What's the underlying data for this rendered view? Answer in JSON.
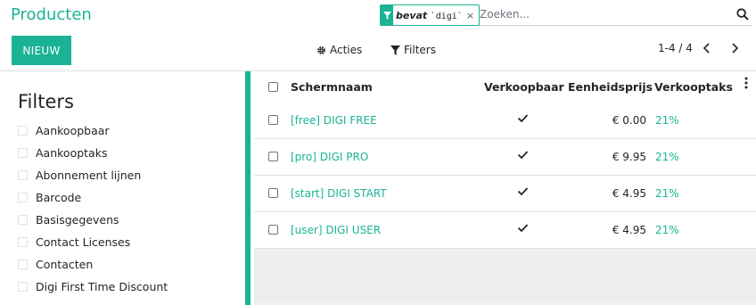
{
  "page_title": "Producten",
  "search": {
    "facet_field": "bevat",
    "facet_value": "`digi`",
    "facet_remove": "×",
    "placeholder": "Zoeken..."
  },
  "toolbar": {
    "new_label": "NIEUW",
    "actions_label": "Acties",
    "filters_label": "Filters",
    "pager": "1-4 / 4"
  },
  "sidebar": {
    "title": "Filters",
    "items": [
      {
        "label": "Aankoopbaar"
      },
      {
        "label": "Aankooptaks"
      },
      {
        "label": "Abonnement lijnen"
      },
      {
        "label": "Barcode"
      },
      {
        "label": "Basisgegevens"
      },
      {
        "label": "Contact Licenses"
      },
      {
        "label": "Contacten"
      },
      {
        "label": "Digi First Time Discount"
      }
    ]
  },
  "table": {
    "columns": [
      "Schermnaam",
      "Verkoopbaar",
      "Eenheidsprijs",
      "Verkooptaks"
    ],
    "rows": [
      {
        "name": "[free] DIGI FREE",
        "sellable": true,
        "price": "€ 0.00",
        "tax": "21%"
      },
      {
        "name": "[pro] DIGI PRO",
        "sellable": true,
        "price": "€ 9.95",
        "tax": "21%"
      },
      {
        "name": "[start] DIGI START",
        "sellable": true,
        "price": "€ 4.95",
        "tax": "21%"
      },
      {
        "name": "[user] DIGI USER",
        "sellable": true,
        "price": "€ 4.95",
        "tax": "21%"
      }
    ]
  },
  "colors": {
    "accent": "#1ab394",
    "list_background": "#efefef"
  }
}
